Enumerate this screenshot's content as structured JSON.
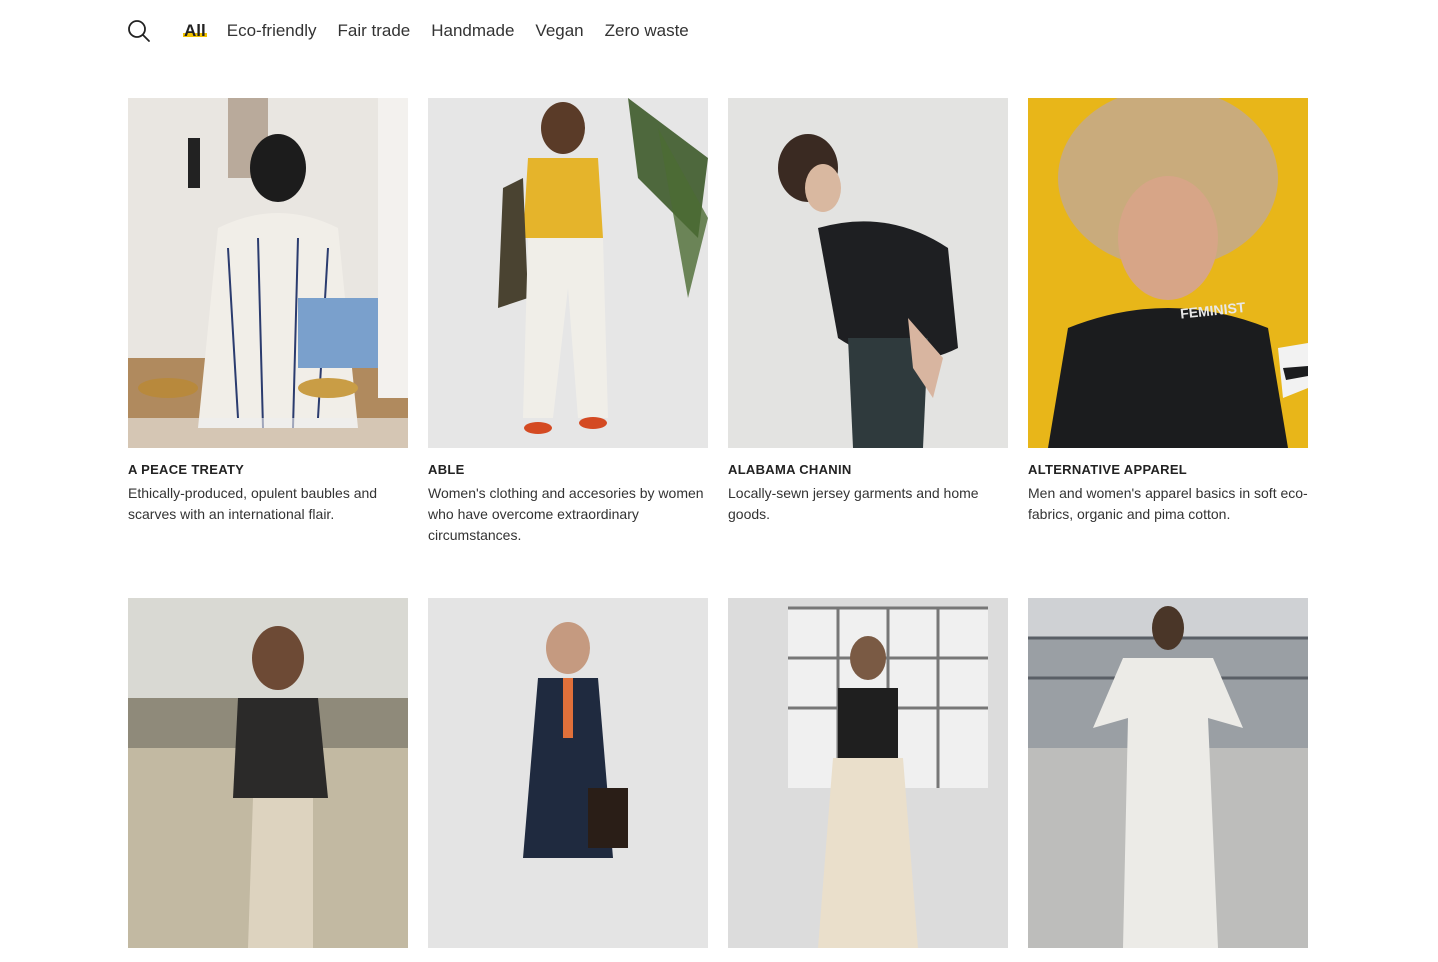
{
  "nav": {
    "search_icon": "search-icon",
    "filters": [
      "All",
      "Eco-friendly",
      "Fair trade",
      "Handmade",
      "Vegan",
      "Zero waste"
    ],
    "active_filter": "All",
    "accent_color": "#f2c300"
  },
  "brands": [
    {
      "name": "A PEACE TREATY",
      "description": "Ethically-produced, opulent baubles and scarves with an international flair."
    },
    {
      "name": "ABLE",
      "description": "Women's clothing and accesories by women who have overcome extraordinary circumstances."
    },
    {
      "name": "ALABAMA CHANIN",
      "description": "Locally-sewn jersey garments and home goods."
    },
    {
      "name": "ALTERNATIVE APPAREL",
      "description": "Men and women's apparel basics in soft eco-fabrics, organic and pima cotton."
    },
    {
      "name": "",
      "description": ""
    },
    {
      "name": "",
      "description": ""
    },
    {
      "name": "",
      "description": ""
    },
    {
      "name": "",
      "description": ""
    }
  ],
  "photo_texts": {
    "feminist_shirt": "FEMINIST"
  }
}
